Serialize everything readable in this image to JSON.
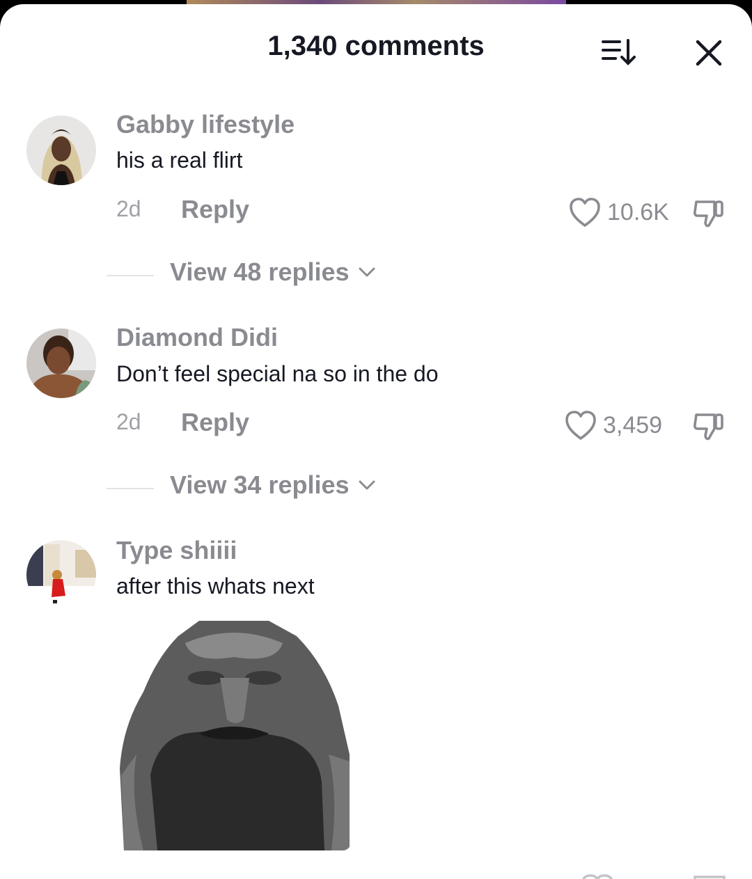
{
  "header": {
    "title": "1,340 comments"
  },
  "comments": [
    {
      "username": "Gabby lifestyle",
      "text": "his a real flirt",
      "time": "2d",
      "reply_label": "Reply",
      "likes": "10.6K",
      "view_replies": "View 48 replies"
    },
    {
      "username": "Diamond Didi",
      "text": "Don’t feel special na so in the do",
      "time": "2d",
      "reply_label": "Reply",
      "likes": "3,459",
      "view_replies": "View 34 replies"
    },
    {
      "username": "Type shiiii",
      "text": "after this whats next",
      "attachment": "sticker-image"
    }
  ],
  "colors": {
    "primary_text": "#161823",
    "secondary_text": "#8a8b91",
    "background": "#ffffff"
  },
  "icons": [
    "sort-icon",
    "close-icon",
    "heart-icon",
    "dislike-icon",
    "chevron-down-icon"
  ]
}
